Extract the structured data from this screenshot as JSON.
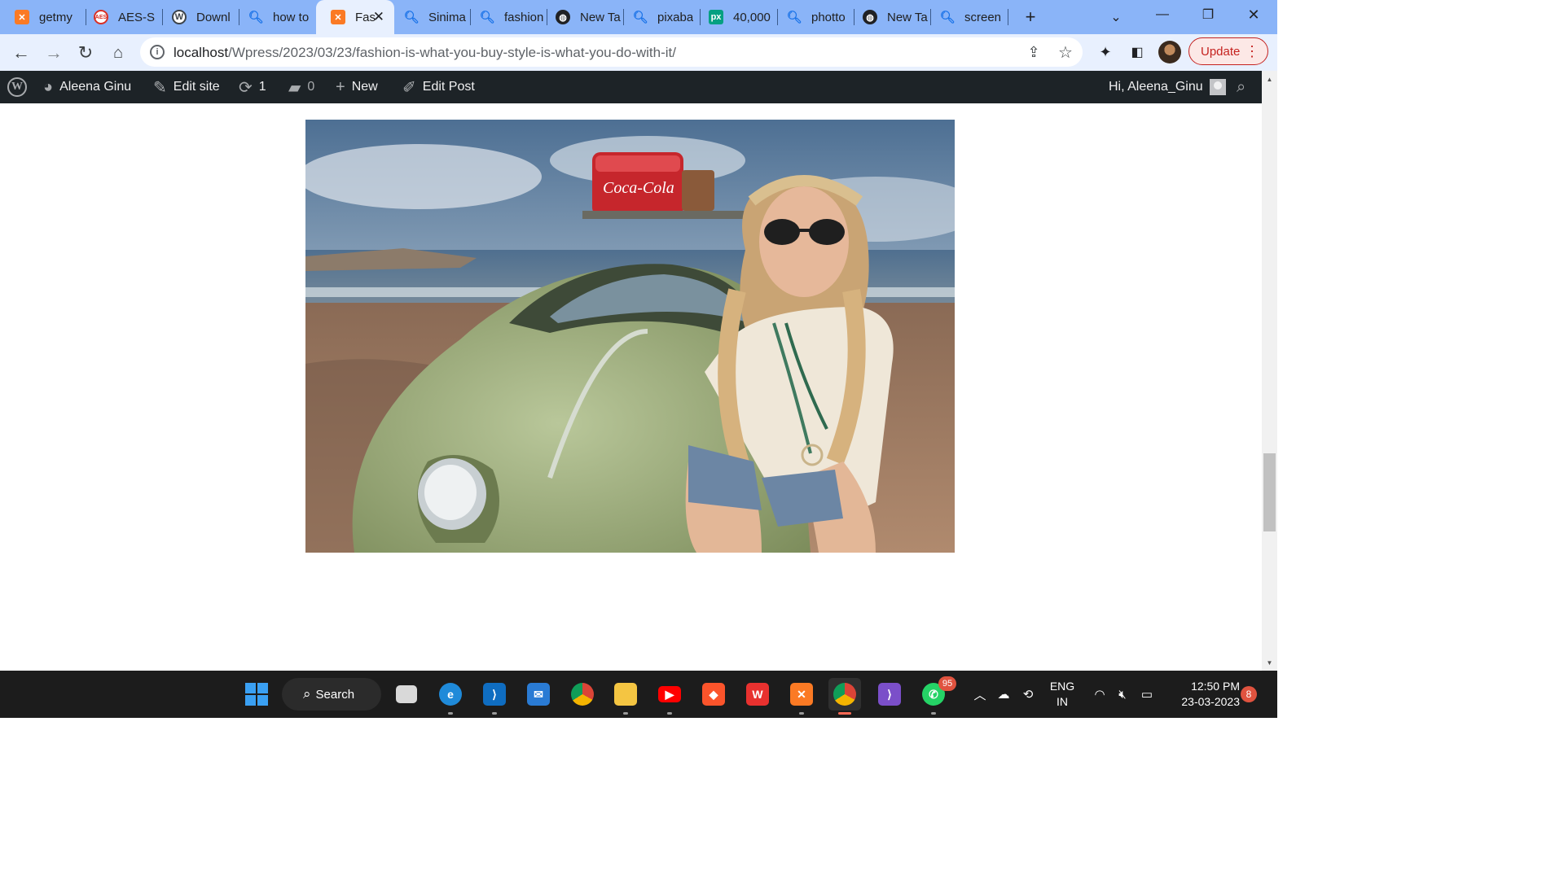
{
  "browser": {
    "tabs": [
      {
        "title": "getmy",
        "favicon": "xampp-icon",
        "active": false
      },
      {
        "title": "AES-S",
        "favicon": "aes-icon",
        "active": false
      },
      {
        "title": "Downl",
        "favicon": "wordpress-icon",
        "active": false
      },
      {
        "title": "how to",
        "favicon": "search-icon",
        "active": false
      },
      {
        "title": "Fas",
        "favicon": "xampp-icon",
        "active": true
      },
      {
        "title": "Sinima",
        "favicon": "search-icon",
        "active": false
      },
      {
        "title": "fashion",
        "favicon": "search-icon",
        "active": false
      },
      {
        "title": "New Ta",
        "favicon": "globe-icon",
        "active": false
      },
      {
        "title": "pixaba",
        "favicon": "search-icon",
        "active": false
      },
      {
        "title": "40,000",
        "favicon": "pexels-icon",
        "active": false
      },
      {
        "title": "photto",
        "favicon": "search-icon",
        "active": false
      },
      {
        "title": "New Ta",
        "favicon": "globe-icon",
        "active": false
      },
      {
        "title": "screen",
        "favicon": "search-icon",
        "active": false
      }
    ],
    "favicon_text": {
      "pexels": "px",
      "aes": "AES",
      "wordpress": "W"
    },
    "url": {
      "host": "localhost",
      "path": "/Wpress/2023/03/23/fashion-is-what-you-buy-style-is-what-you-do-with-it/"
    },
    "update_label": "Update",
    "colors": {
      "tabstrip": "#8ab4f8",
      "toolbar": "#e8f0fe",
      "update": "#c5221f"
    }
  },
  "adminbar": {
    "site_name": "Aleena Ginu",
    "edit_site": "Edit site",
    "updates_count": "1",
    "comments_count": "0",
    "new_label": "New",
    "edit_post": "Edit Post",
    "greeting": "Hi, Aleena_Ginu",
    "colors": {
      "background": "#1d2327",
      "text": "#f0f0f1"
    }
  },
  "taskbar": {
    "search_label": "Search",
    "whatsapp_badge": "95",
    "lang_line1": "ENG",
    "lang_line2": "IN",
    "time": "12:50 PM",
    "date": "23-03-2023",
    "notifications": "8"
  }
}
